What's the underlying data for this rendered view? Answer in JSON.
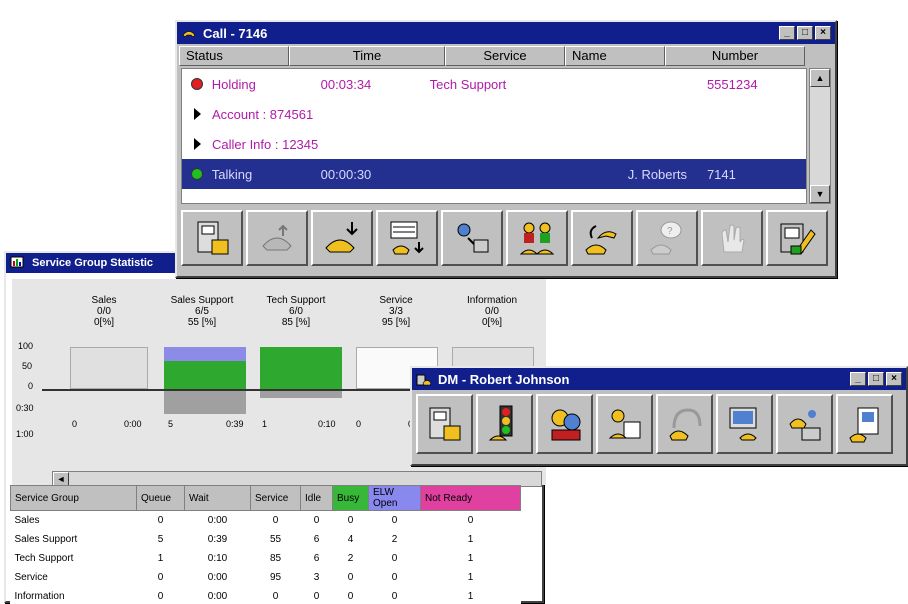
{
  "call_window": {
    "title": "Call - 7146",
    "columns": [
      "Status",
      "Time",
      "Service",
      "Name",
      "Number"
    ],
    "rows": [
      {
        "status": "Holding",
        "time": "00:03:34",
        "service": "Tech Support",
        "name": "",
        "number": "5551234",
        "indicator": "red"
      },
      {
        "label": "Account : 874561"
      },
      {
        "label": "Caller Info : 12345"
      },
      {
        "status": "Talking",
        "time": "00:00:30",
        "service": "",
        "name": "J. Roberts",
        "number": "7141",
        "indicator": "green"
      }
    ],
    "tools": [
      "phone-console-icon",
      "hang-up-icon",
      "answer-icon",
      "transfer-queue-icon",
      "agent-route-icon",
      "conference-icon",
      "call-forward-icon",
      "help-call-icon",
      "hand-icon",
      "notepad-icon"
    ]
  },
  "stats_window": {
    "title": "Service Group Statistic",
    "y_axis": [
      "100",
      "50",
      "0",
      "0:30",
      "1:00"
    ],
    "groups": [
      {
        "name": "Sales",
        "ratio": "0/0",
        "pct": "0[%]",
        "left_val": "0",
        "right_val": "0:00"
      },
      {
        "name": "Sales Support",
        "ratio": "6/5",
        "pct": "55 [%]",
        "left_val": "5",
        "right_val": "0:39"
      },
      {
        "name": "Tech Support",
        "ratio": "6/0",
        "pct": "85 [%]",
        "left_val": "1",
        "right_val": "0:10"
      },
      {
        "name": "Service",
        "ratio": "3/3",
        "pct": "95 [%]",
        "left_val": "0",
        "right_val": "0"
      },
      {
        "name": "Information",
        "ratio": "0/0",
        "pct": "0[%]",
        "left_val": "",
        "right_val": ""
      }
    ],
    "table": {
      "headers": [
        "Service Group",
        "Queue",
        "Wait",
        "Service",
        "Idle",
        "Busy",
        "ELW Open",
        "Not Ready"
      ],
      "rows": [
        [
          "Sales",
          "0",
          "0:00",
          "0",
          "0",
          "0",
          "0",
          "0"
        ],
        [
          "Sales Support",
          "5",
          "0:39",
          "55",
          "6",
          "4",
          "2",
          "1"
        ],
        [
          "Tech Support",
          "1",
          "0:10",
          "85",
          "6",
          "2",
          "0",
          "1"
        ],
        [
          "Service",
          "0",
          "0:00",
          "95",
          "3",
          "0",
          "0",
          "1"
        ],
        [
          "Information",
          "0",
          "0:00",
          "0",
          "0",
          "0",
          "0",
          "1"
        ]
      ]
    },
    "colors": {
      "busy": "#38b838",
      "open": "#8888ee",
      "not_ready": "#e040a0"
    }
  },
  "dm_window": {
    "title": "DM - Robert Johnson",
    "tools": [
      "phone-console-icon",
      "traffic-light-icon",
      "agents-icon",
      "agent-transfer-icon",
      "headset-icon",
      "workstation-icon",
      "key-phone-icon",
      "directory-icon"
    ]
  }
}
